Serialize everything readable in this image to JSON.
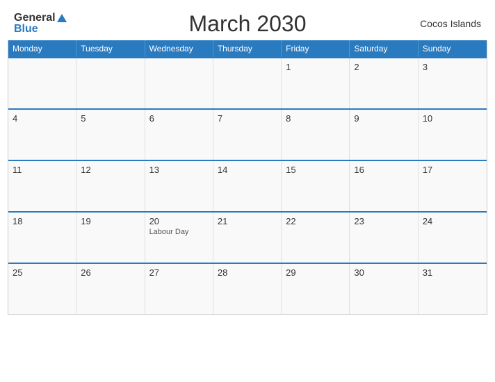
{
  "header": {
    "logo": {
      "general": "General",
      "blue": "Blue",
      "triangle": "▲"
    },
    "title": "March 2030",
    "country": "Cocos Islands"
  },
  "dayHeaders": [
    "Monday",
    "Tuesday",
    "Wednesday",
    "Thursday",
    "Friday",
    "Saturday",
    "Sunday"
  ],
  "weeks": [
    [
      {
        "day": "",
        "holiday": ""
      },
      {
        "day": "",
        "holiday": ""
      },
      {
        "day": "",
        "holiday": ""
      },
      {
        "day": "",
        "holiday": ""
      },
      {
        "day": "1",
        "holiday": ""
      },
      {
        "day": "2",
        "holiday": ""
      },
      {
        "day": "3",
        "holiday": ""
      }
    ],
    [
      {
        "day": "4",
        "holiday": ""
      },
      {
        "day": "5",
        "holiday": ""
      },
      {
        "day": "6",
        "holiday": ""
      },
      {
        "day": "7",
        "holiday": ""
      },
      {
        "day": "8",
        "holiday": ""
      },
      {
        "day": "9",
        "holiday": ""
      },
      {
        "day": "10",
        "holiday": ""
      }
    ],
    [
      {
        "day": "11",
        "holiday": ""
      },
      {
        "day": "12",
        "holiday": ""
      },
      {
        "day": "13",
        "holiday": ""
      },
      {
        "day": "14",
        "holiday": ""
      },
      {
        "day": "15",
        "holiday": ""
      },
      {
        "day": "16",
        "holiday": ""
      },
      {
        "day": "17",
        "holiday": ""
      }
    ],
    [
      {
        "day": "18",
        "holiday": ""
      },
      {
        "day": "19",
        "holiday": ""
      },
      {
        "day": "20",
        "holiday": "Labour Day"
      },
      {
        "day": "21",
        "holiday": ""
      },
      {
        "day": "22",
        "holiday": ""
      },
      {
        "day": "23",
        "holiday": ""
      },
      {
        "day": "24",
        "holiday": ""
      }
    ],
    [
      {
        "day": "25",
        "holiday": ""
      },
      {
        "day": "26",
        "holiday": ""
      },
      {
        "day": "27",
        "holiday": ""
      },
      {
        "day": "28",
        "holiday": ""
      },
      {
        "day": "29",
        "holiday": ""
      },
      {
        "day": "30",
        "holiday": ""
      },
      {
        "day": "31",
        "holiday": ""
      }
    ]
  ]
}
